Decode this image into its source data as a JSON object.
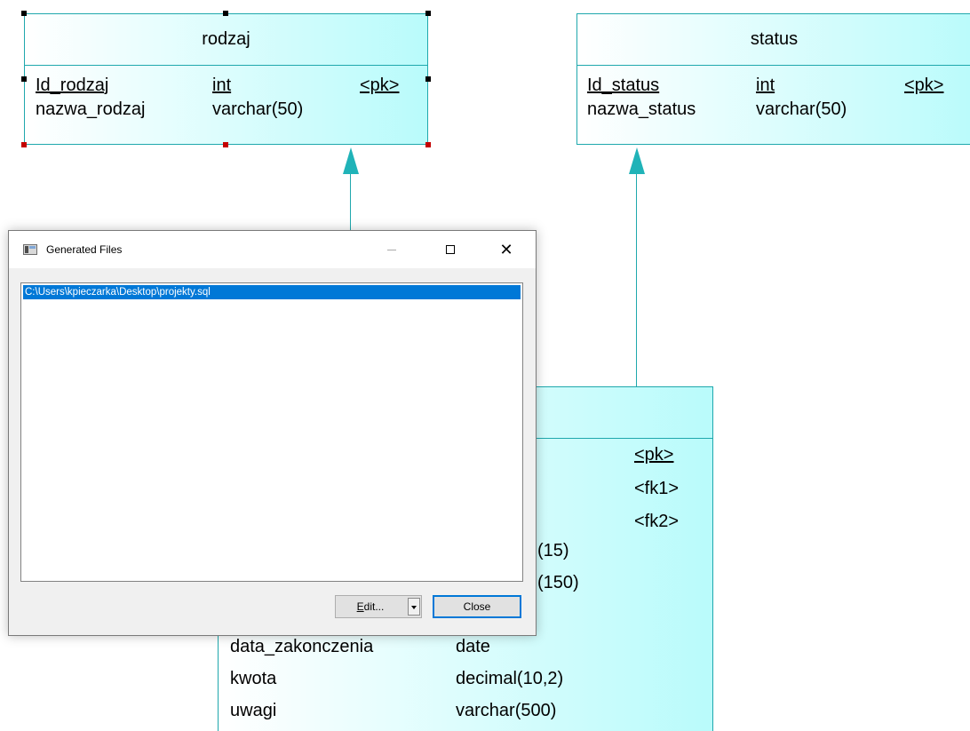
{
  "diagram": {
    "entities": {
      "rodzaj": {
        "name": "rodzaj",
        "attributes": [
          {
            "name": "Id_rodzaj",
            "type": "int",
            "key": "<pk>"
          },
          {
            "name": "nazwa_rodzaj",
            "type": "varchar(50)",
            "key": ""
          }
        ]
      },
      "status": {
        "name": "status",
        "attributes": [
          {
            "name": "Id_status",
            "type": "int",
            "key": "<pk>"
          },
          {
            "name": "nazwa_status",
            "type": "varchar(50)",
            "key": ""
          }
        ]
      },
      "projekt": {
        "visible_keys": [
          "<pk>",
          "<fk1>",
          "<fk2>"
        ],
        "visible_types_partial": [
          "(15)",
          "(150)"
        ],
        "attributes": [
          {
            "name": "data_zakonczenia",
            "type": "date"
          },
          {
            "name": "kwota",
            "type": "decimal(10,2)"
          },
          {
            "name": "uwagi",
            "type": "varchar(500)"
          }
        ]
      }
    },
    "colors": {
      "border": "#1fa8ad",
      "fill_end": "#b9fbfb",
      "arrow": "#20b3b8"
    }
  },
  "dialog": {
    "title": "Generated Files",
    "title_icon": "window-app-icon",
    "controls": {
      "minimize": "minimize-icon",
      "maximize": "maximize-icon",
      "close": "close-icon",
      "close_glyph": "✕"
    },
    "files": [
      "C:\\Users\\kpieczarka\\Desktop\\projekty.sql"
    ],
    "edit_button": {
      "accel": "E",
      "rest": "dit..."
    },
    "close_button_label": "Close",
    "colors": {
      "selection": "#0078d7",
      "dialog_bg": "#f0f0f0"
    }
  }
}
